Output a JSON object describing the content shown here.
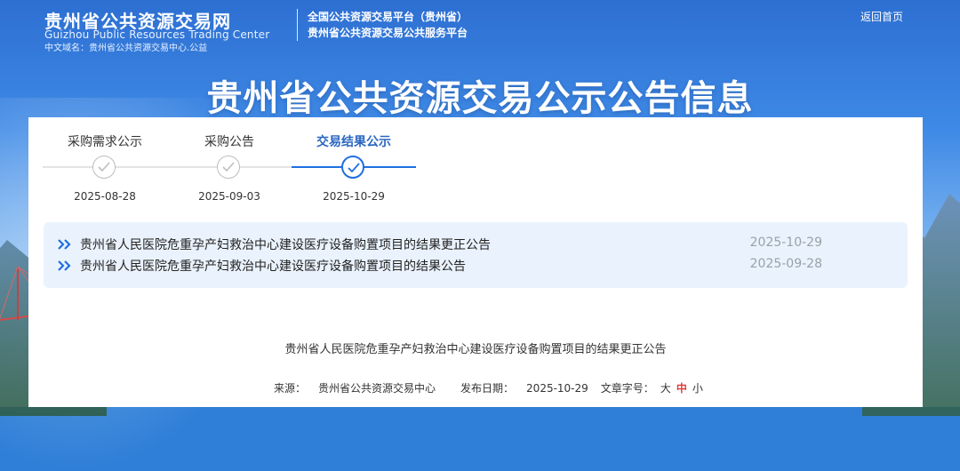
{
  "header": {
    "logo_cn": "贵州省公共资源交易网",
    "logo_en": "Guizhou Public Resources Trading Center",
    "logo_domain": "中文域名：贵州省公共资源交易中心.公益",
    "platform_line1": "全国公共资源交易平台（贵州省）",
    "platform_line2": "贵州省公共资源交易公共服务平台",
    "return_link": "返回首页"
  },
  "main_title": "贵州省公共资源交易公示公告信息",
  "tabs": [
    {
      "label": "采购需求公示",
      "date": "2025-08-28",
      "active": false
    },
    {
      "label": "采购公告",
      "date": "2025-09-03",
      "active": false
    },
    {
      "label": "交易结果公示",
      "date": "2025-10-29",
      "active": true
    }
  ],
  "notices": [
    {
      "title": "贵州省人民医院危重孕产妇救治中心建设医疗设备购置项目的结果更正公告",
      "date": "2025-10-29"
    },
    {
      "title": "贵州省人民医院危重孕产妇救治中心建设医疗设备购置项目的结果公告",
      "date": "2025-09-28"
    }
  ],
  "document": {
    "title": "贵州省人民医院危重孕产妇救治中心建设医疗设备购置项目的结果更正公告",
    "source_label": "来源：",
    "source_value": "贵州省公共资源交易中心",
    "publish_label": "发布日期：",
    "publish_value": "2025-10-29",
    "font_size_label": "文章字号：",
    "size_large": "大",
    "size_medium": "中",
    "size_small": "小"
  },
  "colors": {
    "accent": "#1f6fe0",
    "active_tab_text": "#2b67c2",
    "list_background": "#eaf3fd",
    "selected_size": "#e03b3b"
  },
  "icons": {
    "step": "check-circle-icon",
    "row": "double-chevron-right-icon"
  }
}
